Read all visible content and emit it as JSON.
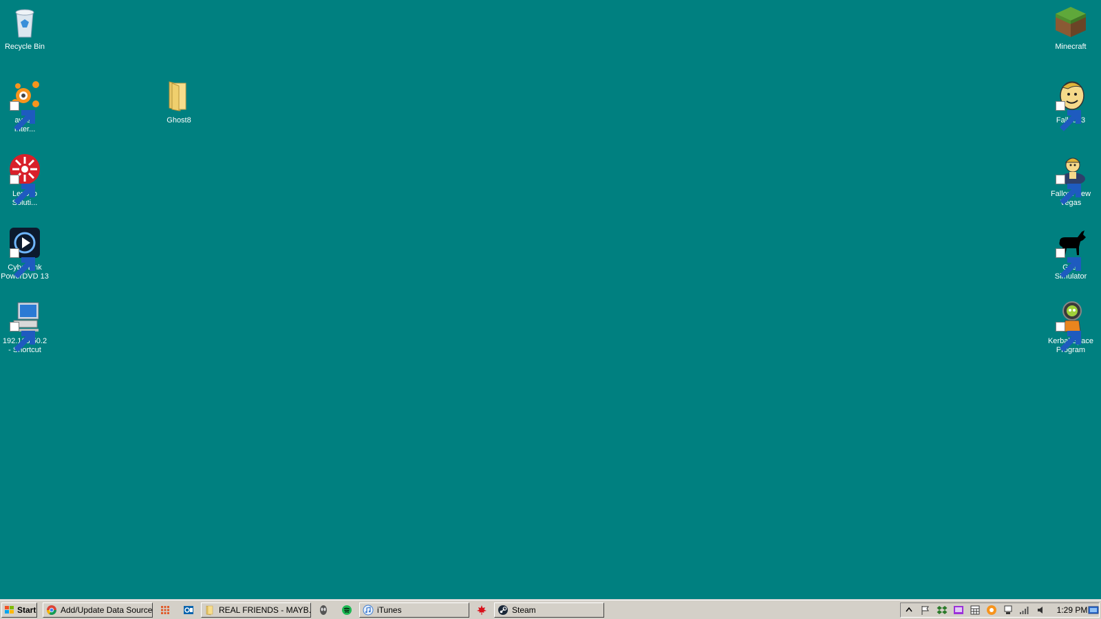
{
  "desktop": {
    "background": "#008080",
    "left_icons": [
      {
        "label": "Recycle Bin",
        "icon": "recycle-bin-icon"
      },
      {
        "label": "avast!\nInter...",
        "icon": "avast-icon"
      },
      {
        "label": "Lenovo\nSoluti...",
        "icon": "lenovo-solution-icon"
      },
      {
        "label": "CyberLink\nPowerDVD 13",
        "icon": "powerdvd-icon"
      },
      {
        "label": "192.168.50.2\n- Shortcut",
        "icon": "network-computer-icon"
      }
    ],
    "folder": {
      "label": "Ghost8",
      "icon": "folder-icon"
    },
    "right_icons": [
      {
        "label": "Minecraft",
        "icon": "minecraft-icon"
      },
      {
        "label": "Fallout 3",
        "icon": "fallout3-icon"
      },
      {
        "label": "Fallout New\nVegas",
        "icon": "fallout-new-vegas-icon"
      },
      {
        "label": "Goat Simulator",
        "icon": "goat-simulator-icon"
      },
      {
        "label": "Kerbal Space\nProgram",
        "icon": "kerbal-space-program-icon"
      }
    ]
  },
  "taskbar": {
    "start_label": "Start",
    "buttons": [
      {
        "label": "Add/Update Data Source...",
        "icon": "chrome-icon"
      },
      {
        "label": "REAL FRIENDS - MAYB...",
        "icon": "folder-icon"
      },
      {
        "label": "iTunes",
        "icon": "itunes-icon"
      },
      {
        "label": "Steam",
        "icon": "steam-icon"
      }
    ],
    "quick_icons": [
      "app-grid-icon",
      "outlook-icon",
      "alienware-icon",
      "spotify-icon",
      "maple-leaf-icon"
    ],
    "tray_icons": [
      "show-hidden-icon",
      "flag-icon",
      "dropbox-icon",
      "monitor-icon",
      "calendar-icon",
      "avast-tray-icon",
      "network-icon",
      "signal-icon",
      "volume-icon"
    ],
    "clock": "1:29 PM"
  }
}
